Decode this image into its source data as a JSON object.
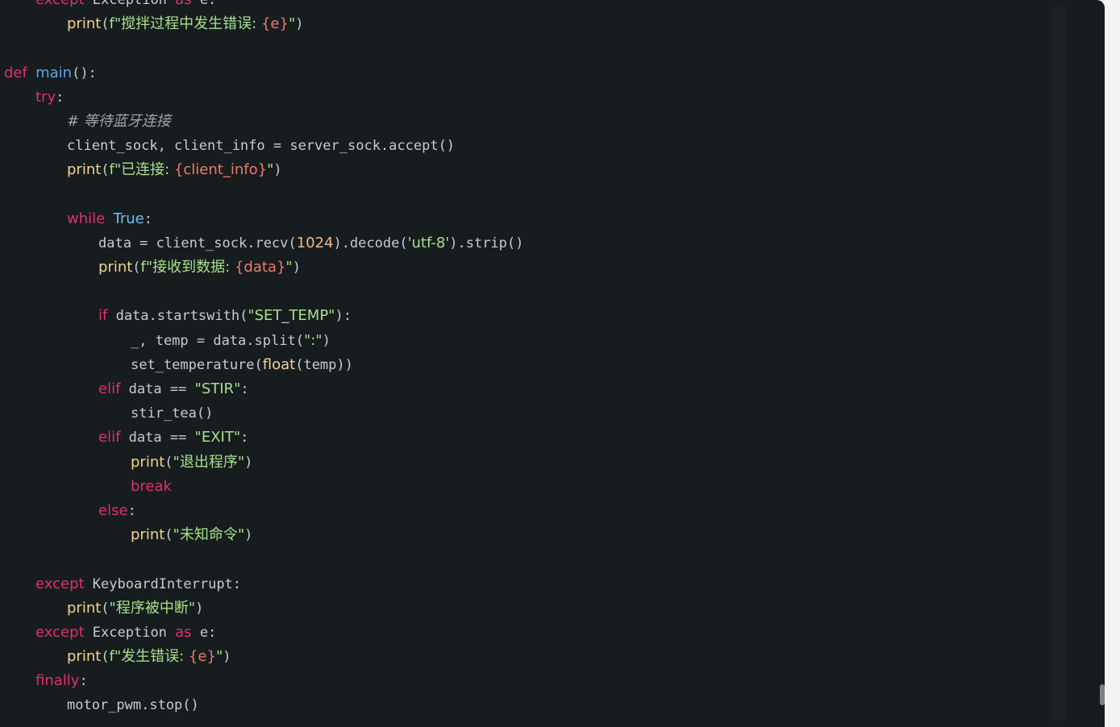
{
  "editor": {
    "lines": [
      {
        "indent": 1,
        "tokens": [
          [
            "kw",
            "except"
          ],
          [
            "pl",
            " Exception "
          ],
          [
            "kw",
            "as"
          ],
          [
            "pl",
            " e:"
          ]
        ]
      },
      {
        "indent": 2,
        "tokens": [
          [
            "fn",
            "print"
          ],
          [
            "pl",
            "("
          ],
          [
            "str",
            "f\"搅拌过程中发生错误: "
          ],
          [
            "ipl",
            "{e}"
          ],
          [
            "str",
            "\""
          ],
          [
            "pl",
            ")"
          ]
        ]
      },
      {
        "indent": 0,
        "tokens": []
      },
      {
        "indent": 0,
        "tokens": [
          [
            "kw",
            "def"
          ],
          [
            "pl",
            " "
          ],
          [
            "def",
            "main"
          ],
          [
            "pl",
            "():"
          ]
        ]
      },
      {
        "indent": 1,
        "tokens": [
          [
            "kw",
            "try"
          ],
          [
            "pl",
            ":"
          ]
        ]
      },
      {
        "indent": 2,
        "tokens": [
          [
            "cmt",
            "# 等待蓝牙连接"
          ]
        ]
      },
      {
        "indent": 2,
        "tokens": [
          [
            "pl",
            "client_sock, client_info = server_sock.accept()"
          ]
        ]
      },
      {
        "indent": 2,
        "tokens": [
          [
            "fn",
            "print"
          ],
          [
            "pl",
            "("
          ],
          [
            "str",
            "f\"已连接: "
          ],
          [
            "ipl",
            "{client_info}"
          ],
          [
            "str",
            "\""
          ],
          [
            "pl",
            ")"
          ]
        ]
      },
      {
        "indent": 0,
        "tokens": []
      },
      {
        "indent": 2,
        "tokens": [
          [
            "kw",
            "while"
          ],
          [
            "pl",
            " "
          ],
          [
            "cnst",
            "True"
          ],
          [
            "pl",
            ":"
          ]
        ]
      },
      {
        "indent": 3,
        "tokens": [
          [
            "pl",
            "data = client_sock.recv("
          ],
          [
            "num",
            "1024"
          ],
          [
            "pl",
            ").decode("
          ],
          [
            "str",
            "'utf-8'"
          ],
          [
            "pl",
            ").strip()"
          ]
        ]
      },
      {
        "indent": 3,
        "tokens": [
          [
            "fn",
            "print"
          ],
          [
            "pl",
            "("
          ],
          [
            "str",
            "f\"接收到数据: "
          ],
          [
            "ipl",
            "{data}"
          ],
          [
            "str",
            "\""
          ],
          [
            "pl",
            ")"
          ]
        ]
      },
      {
        "indent": 0,
        "tokens": []
      },
      {
        "indent": 3,
        "tokens": [
          [
            "kw",
            "if"
          ],
          [
            "pl",
            " data.startswith("
          ],
          [
            "str",
            "\"SET_TEMP\""
          ],
          [
            "pl",
            "):"
          ]
        ]
      },
      {
        "indent": 4,
        "tokens": [
          [
            "pl",
            "_, temp = data.split("
          ],
          [
            "str",
            "\":\""
          ],
          [
            "pl",
            ")"
          ]
        ]
      },
      {
        "indent": 4,
        "tokens": [
          [
            "pl",
            "set_temperature("
          ],
          [
            "fn",
            "float"
          ],
          [
            "pl",
            "(temp))"
          ]
        ]
      },
      {
        "indent": 3,
        "tokens": [
          [
            "kw",
            "elif"
          ],
          [
            "pl",
            " data == "
          ],
          [
            "str",
            "\"STIR\""
          ],
          [
            "pl",
            ":"
          ]
        ]
      },
      {
        "indent": 4,
        "tokens": [
          [
            "pl",
            "stir_tea()"
          ]
        ]
      },
      {
        "indent": 3,
        "tokens": [
          [
            "kw",
            "elif"
          ],
          [
            "pl",
            " data == "
          ],
          [
            "str",
            "\"EXIT\""
          ],
          [
            "pl",
            ":"
          ]
        ]
      },
      {
        "indent": 4,
        "tokens": [
          [
            "fn",
            "print"
          ],
          [
            "pl",
            "("
          ],
          [
            "str",
            "\"退出程序\""
          ],
          [
            "pl",
            ")"
          ]
        ]
      },
      {
        "indent": 4,
        "tokens": [
          [
            "kw",
            "break"
          ]
        ]
      },
      {
        "indent": 3,
        "tokens": [
          [
            "kw",
            "else"
          ],
          [
            "pl",
            ":"
          ]
        ]
      },
      {
        "indent": 4,
        "tokens": [
          [
            "fn",
            "print"
          ],
          [
            "pl",
            "("
          ],
          [
            "str",
            "\"未知命令\""
          ],
          [
            "pl",
            ")"
          ]
        ]
      },
      {
        "indent": 0,
        "tokens": []
      },
      {
        "indent": 1,
        "tokens": [
          [
            "kw",
            "except"
          ],
          [
            "pl",
            " KeyboardInterrupt:"
          ]
        ]
      },
      {
        "indent": 2,
        "tokens": [
          [
            "fn",
            "print"
          ],
          [
            "pl",
            "("
          ],
          [
            "str",
            "\"程序被中断\""
          ],
          [
            "pl",
            ")"
          ]
        ]
      },
      {
        "indent": 1,
        "tokens": [
          [
            "kw",
            "except"
          ],
          [
            "pl",
            " Exception "
          ],
          [
            "kw",
            "as"
          ],
          [
            "pl",
            " e:"
          ]
        ]
      },
      {
        "indent": 2,
        "tokens": [
          [
            "fn",
            "print"
          ],
          [
            "pl",
            "("
          ],
          [
            "str",
            "f\"发生错误: "
          ],
          [
            "ipl",
            "{e}"
          ],
          [
            "str",
            "\""
          ],
          [
            "pl",
            ")"
          ]
        ]
      },
      {
        "indent": 1,
        "tokens": [
          [
            "kw",
            "finally"
          ],
          [
            "pl",
            ":"
          ]
        ]
      },
      {
        "indent": 2,
        "tokens": [
          [
            "pl",
            "motor_pwm.stop()"
          ]
        ]
      }
    ]
  },
  "colors": {
    "background": "#171c1f",
    "keyword": "#e0306a",
    "function": "#f2d48a",
    "definition": "#5aa8e6",
    "string": "#a6e08a",
    "interpolation": "#f07a6a",
    "number": "#f2b880",
    "constant": "#6ec0e8",
    "comment": "#a0a4a8",
    "plain": "#c8ccd0"
  }
}
